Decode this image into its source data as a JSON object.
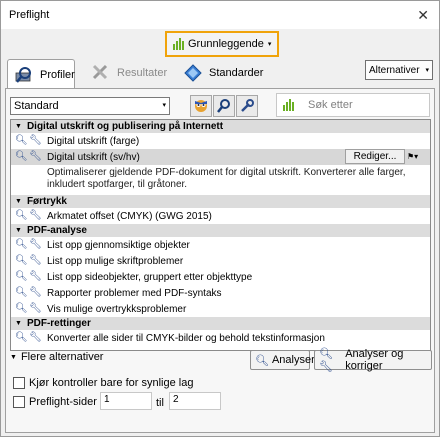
{
  "window": {
    "title": "Preflight",
    "close": "✕"
  },
  "mode_button": {
    "label": "Grunnleggende",
    "arrow": "▾"
  },
  "tabs": [
    {
      "label": "Profiler",
      "state": "active"
    },
    {
      "label": "Resultater",
      "state": "disabled"
    },
    {
      "label": "Standarder",
      "state": "normal"
    }
  ],
  "options_button": {
    "label": "Alternativer",
    "arrow": "▾"
  },
  "toolbar": {
    "profile_select": "Standard",
    "select_arrow": "▾",
    "search_placeholder": "Søk etter"
  },
  "groups": [
    {
      "label": "Digital utskrift og publisering på Internett",
      "items": [
        {
          "label": "Digital utskrift (farge)"
        },
        {
          "label": "Digital utskrift (sv/hv)",
          "selected": true,
          "edit_label": "Rediger...",
          "description": "Optimaliserer gjeldende PDF-dokument for digital utskrift. Konverterer alle farger, inkludert spotfarger, til gråtoner."
        }
      ]
    },
    {
      "label": "Førtrykk",
      "items": [
        {
          "label": "Arkmatet offset (CMYK) (GWG 2015)"
        }
      ]
    },
    {
      "label": "PDF-analyse",
      "items": [
        {
          "label": "List opp gjennomsiktige objekter"
        },
        {
          "label": "List opp mulige skriftproblemer"
        },
        {
          "label": "List opp sideobjekter, gruppert etter objekttype"
        },
        {
          "label": "Rapporter problemer med PDF-syntaks"
        },
        {
          "label": "Vis mulige overtrykksproblemer"
        }
      ]
    },
    {
      "label": "PDF-rettinger",
      "items": [
        {
          "label": "Konverter alle sider til CMYK-bilder og behold tekstinformasjon"
        }
      ]
    }
  ],
  "footer": {
    "more_options": "Flere alternativer",
    "analyze": "Analyser",
    "analyze_fix": "Analyser og korriger",
    "visible_layers": "Kjør kontroller bare for synlige lag",
    "pages_label": "Preflight-sider",
    "from_page": "1",
    "to_label": "til",
    "to_page": "2"
  },
  "colors": {
    "accent_highlight": "#f0a30a",
    "icon_green": "#6ab023"
  }
}
